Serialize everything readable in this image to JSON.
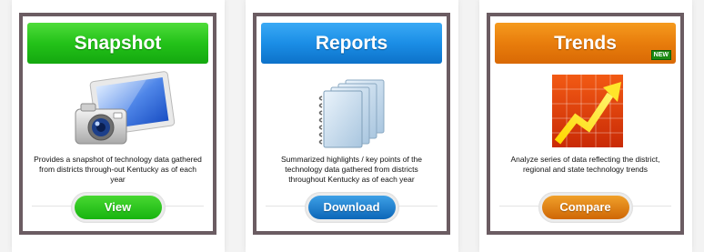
{
  "colors": {
    "frame_border": "#6b5c62",
    "snapshot_green": "#23c219",
    "reports_blue": "#1b8ee6",
    "trends_orange": "#e87d0c"
  },
  "cards": [
    {
      "title": "Snapshot",
      "icon": "camera-icon",
      "description": "Provides a snapshot of technology data gathered from districts through-out Kentucky as of each year",
      "button_label": "View"
    },
    {
      "title": "Reports",
      "icon": "notebooks-icon",
      "description": "Summarized highlights / key points of the technology data gathered from districts throughout Kentucky as of each year",
      "button_label": "Download"
    },
    {
      "title": "Trends",
      "badge": "NEW",
      "icon": "trend-chart-icon",
      "description": "Analyze series of data reflecting the district, regional and state technology trends",
      "button_label": "Compare"
    }
  ]
}
